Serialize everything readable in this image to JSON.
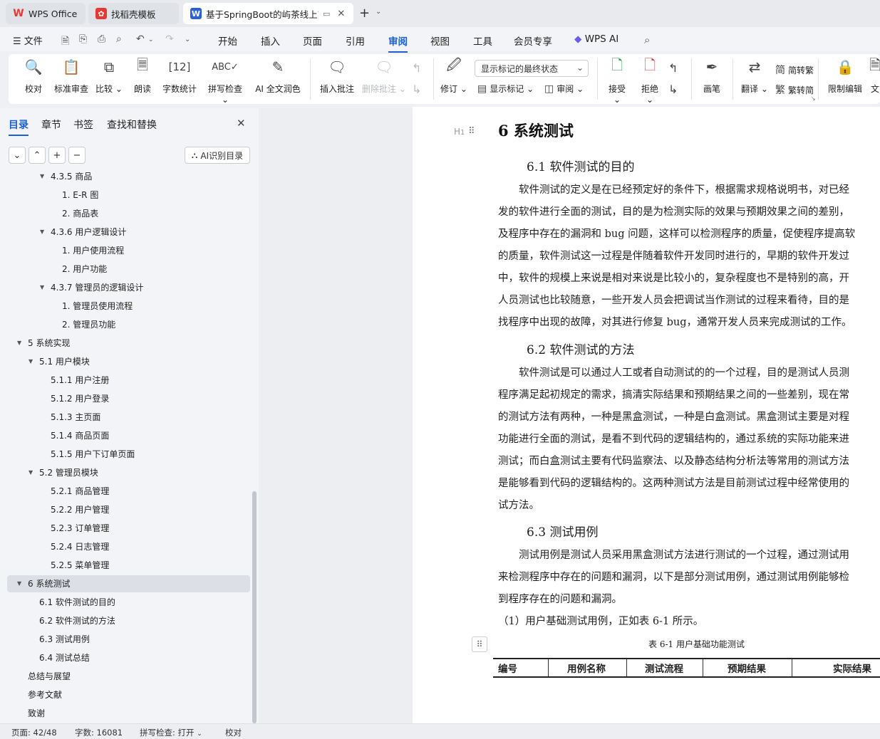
{
  "tabs": [
    {
      "label": "WPS Office",
      "logo": "W",
      "color": "#e8382f"
    },
    {
      "label": "找稻壳模板",
      "logo": "✿",
      "color": "#e8382f"
    },
    {
      "label": "基于SpringBoot的屿茶线上商",
      "logo": "W",
      "color": "#2a5fd8"
    }
  ],
  "menu": {
    "file": "文件",
    "items": [
      "开始",
      "插入",
      "页面",
      "引用",
      "审阅",
      "视图",
      "工具",
      "会员专享"
    ],
    "active": "审阅",
    "ai": "WPS AI"
  },
  "ribbon": {
    "proof": "校对",
    "std_review": "标准审查",
    "compare": "比较",
    "read": "朗读",
    "wordcount": "字数统计",
    "spell": "拼写检查",
    "ai_polish": "AI 全文润色",
    "insert_comment": "插入批注",
    "delete_comment": "删除批注",
    "revise": "修订",
    "show_mode": "显示标记的最终状态",
    "show_marks": "显示标记",
    "review": "审阅",
    "accept": "接受",
    "reject": "拒绝",
    "pen": "画笔",
    "translate": "翻译",
    "to_trad": "简转繁",
    "to_simp": "繁转简",
    "restrict": "限制编辑",
    "doc_more": "文"
  },
  "panel": {
    "tabs": [
      "目录",
      "章节",
      "书签",
      "查找和替换"
    ],
    "ai_toc": "AI识别目录",
    "toc": [
      {
        "label": "4.3.5 商品",
        "level": 2,
        "caret": "down"
      },
      {
        "label": "1. E-R 图",
        "level": 3
      },
      {
        "label": "2. 商品表",
        "level": 3
      },
      {
        "label": "4.3.6 用户逻辑设计",
        "level": 2,
        "caret": "down"
      },
      {
        "label": "1. 用户使用流程",
        "level": 3
      },
      {
        "label": "2. 用户功能",
        "level": 3
      },
      {
        "label": "4.3.7 管理员的逻辑设计",
        "level": 2,
        "caret": "down"
      },
      {
        "label": "1. 管理员使用流程",
        "level": 3
      },
      {
        "label": "2. 管理员功能",
        "level": 3
      },
      {
        "label": "5 系统实现",
        "level": 0,
        "caret": "down"
      },
      {
        "label": "5.1 用户模块",
        "level": 1,
        "caret": "down"
      },
      {
        "label": "5.1.1 用户注册",
        "level": 2
      },
      {
        "label": "5.1.2 用户登录",
        "level": 2
      },
      {
        "label": "5.1.3 主页面",
        "level": 2
      },
      {
        "label": "5.1.4 商品页面",
        "level": 2
      },
      {
        "label": "5.1.5 用户下订单页面",
        "level": 2
      },
      {
        "label": "5.2 管理员模块",
        "level": 1,
        "caret": "down"
      },
      {
        "label": "5.2.1 商品管理",
        "level": 2
      },
      {
        "label": "5.2.2 用户管理",
        "level": 2
      },
      {
        "label": "5.2.3 订单管理",
        "level": 2
      },
      {
        "label": "5.2.4 日志管理",
        "level": 2
      },
      {
        "label": "5.2.5 菜单管理",
        "level": 2
      },
      {
        "label": "6 系统测试",
        "level": 0,
        "caret": "down",
        "highlight": true
      },
      {
        "label": "6.1 软件测试的目的",
        "level": 1
      },
      {
        "label": "6.2 软件测试的方法",
        "level": 1
      },
      {
        "label": "6.3 测试用例",
        "level": 1
      },
      {
        "label": "6.4 测试总结",
        "level": 1
      },
      {
        "label": "总结与展望",
        "level": 0
      },
      {
        "label": "参考文献",
        "level": 0
      },
      {
        "label": "致谢",
        "level": 0
      }
    ]
  },
  "doc": {
    "h1": "6  系统测试",
    "h2_1": "6.1  软件测试的目的",
    "p1": [
      "　　软件测试的定义是在已经预定好的条件下，根据需求规格说明书，对已经",
      "发的软件进行全面的测试，目的是为检测实际的效果与预期效果之间的差别，",
      "及程序中存在的漏洞和 bug 问题，这样可以检测程序的质量，促使程序提高软",
      "的质量，软件测试这一过程是伴随着软件开发同时进行的，早期的软件开发过",
      "中，软件的规模上来说是相对来说是比较小的，复杂程度也不是特别的高，开",
      "人员测试也比较随意，一些开发人员会把调试当作测试的过程来看待，目的是",
      "找程序中出现的故障，对其进行修复 bug，通常开发人员来完成测试的工作。"
    ],
    "h2_2": "6.2  软件测试的方法",
    "p2": [
      "　　软件测试是可以通过人工或者自动测试的的一个过程，目的是测试人员测",
      "程序满足起初规定的需求，搞清实际结果和预期结果之间的一些差别，现在常",
      "的测试方法有两种，一种是黑盒测试，一种是白盒测试。黑盒测试主要是对程",
      "功能进行全面的测试，是看不到代码的逻辑结构的，通过系统的实际功能来进",
      "测试；而白盒测试主要有代码监察法、以及静态结构分析法等常用的测试方法",
      "是能够看到代码的逻辑结构的。这两种测试方法是目前测试过程中经常使用的",
      "试方法。"
    ],
    "h2_3": "6.3  测试用例",
    "p3": [
      "　　测试用例是测试人员采用黑盒测试方法进行测试的一个过程，通过测试用",
      "来检测程序中存在的问题和漏洞，以下是部分测试用例，通过测试用例能够检",
      "到程序存在的问题和漏洞。",
      "（1）用户基础测试用例，正如表 6-1 所示。"
    ],
    "caption": "表 6-1    用户基础功能测试",
    "table_headers": [
      "编号",
      "用例名称",
      "测试流程",
      "预期结果",
      "实际结果"
    ]
  },
  "status": {
    "page": "页面: 42/48",
    "words": "字数: 16081",
    "spell": "拼写检查: 打开",
    "proof": "校对"
  }
}
